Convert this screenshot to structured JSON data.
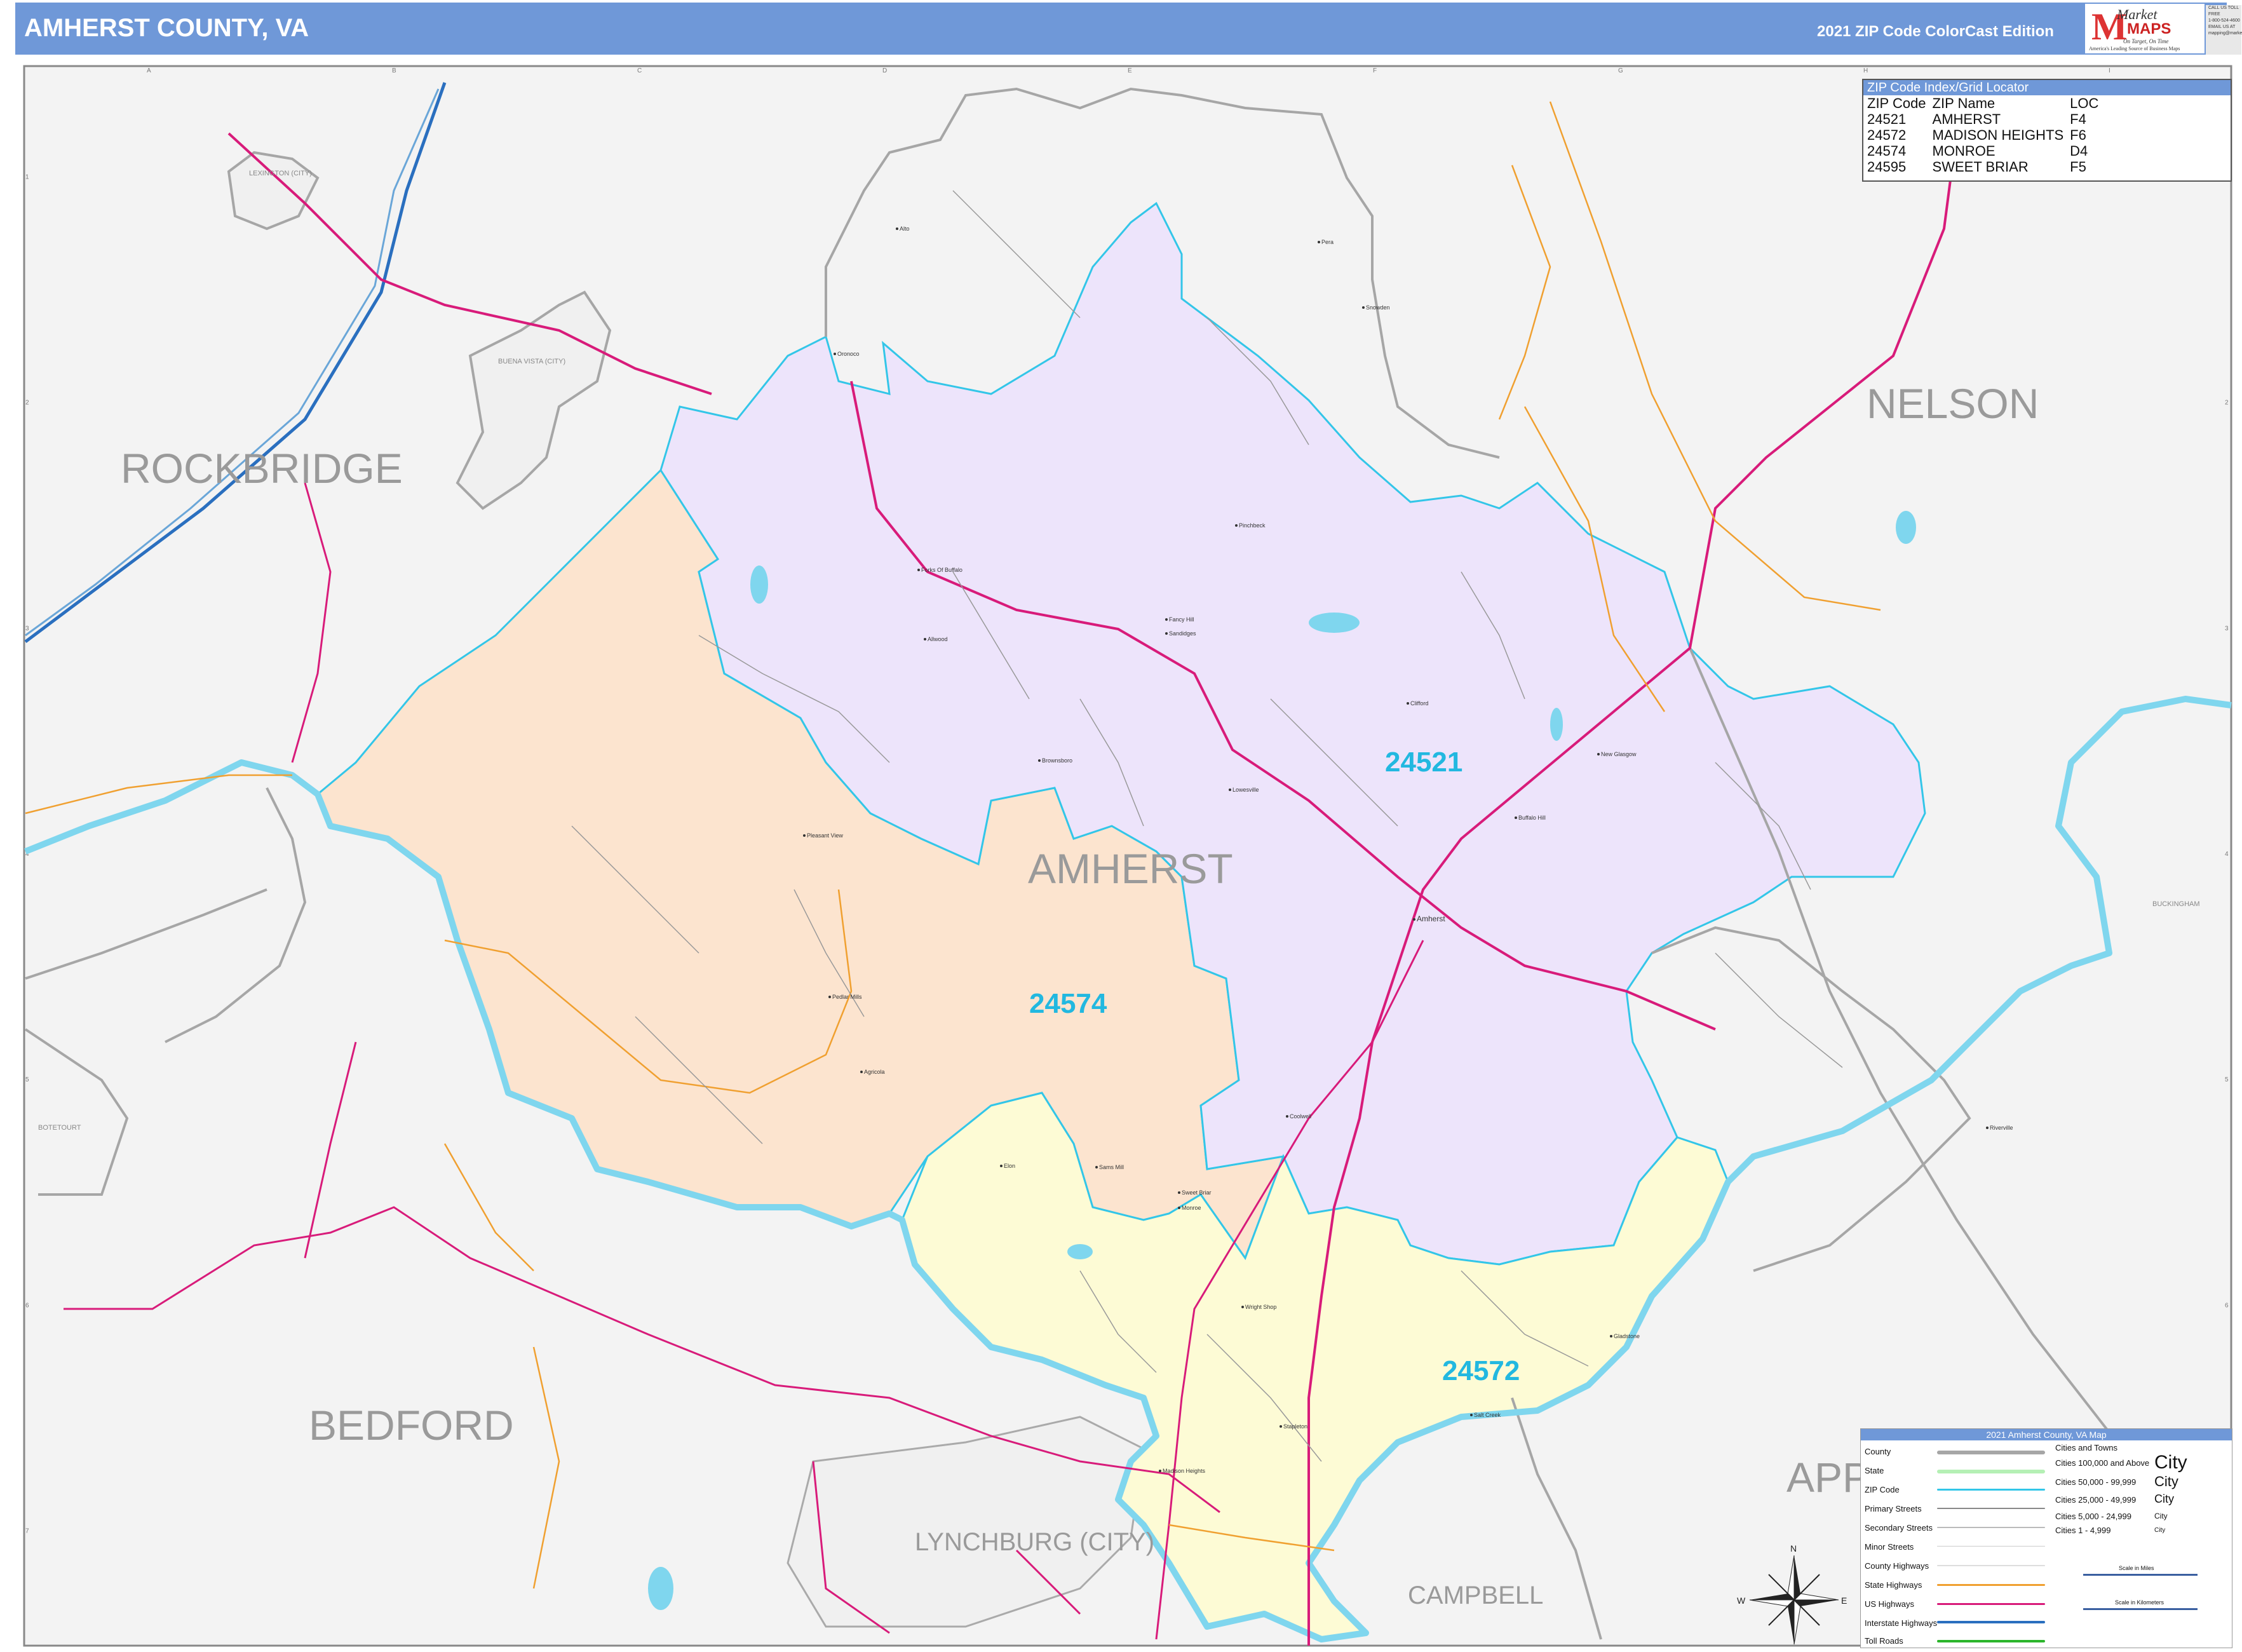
{
  "header": {
    "title": "AMHERST COUNTY, VA",
    "edition": "2021 ZIP Code ColorCast Edition",
    "logo_brand": "Market",
    "logo_maps": "MAPS",
    "logo_tagline": "On Target, On Time",
    "logo_subtitle": "America's Leading Source of Business Maps",
    "contact_lines": [
      "CALL US TOLL FREE",
      "1-800-524-4600",
      "EMAIL US AT",
      "mapping@marketmaps.com"
    ]
  },
  "grid": {
    "columns": [
      "A",
      "B",
      "C",
      "D",
      "E",
      "F",
      "G",
      "H",
      "I"
    ],
    "rows": [
      "1",
      "2",
      "3",
      "4",
      "5",
      "6",
      "7"
    ]
  },
  "counties": {
    "rockbridge": "ROCKBRIDGE",
    "nelson": "NELSON",
    "amherst": "AMHERST",
    "bedford": "BEDFORD",
    "lynchburg": "LYNCHBURG (CITY)",
    "campbell": "CAMPBELL",
    "appomattox": "APP",
    "buena_vista": "BUENA VISTA (CITY)",
    "lexington": "LEXINGTON (CITY)",
    "botetourt": "BOTETOURT",
    "buckingham": "BUCKINGHAM"
  },
  "zip_labels": {
    "z24521": "24521",
    "z24574": "24574",
    "z24572": "24572"
  },
  "places": [
    "Amherst",
    "Madison Heights",
    "Monroe",
    "Sweet Briar",
    "Pedlar Mills",
    "Buffalo Hill",
    "New Glasgow",
    "Clifford",
    "Sandidges",
    "Fancy Hill",
    "Alto",
    "Oronoco",
    "Forks Of Buffalo",
    "Allwood",
    "Brownsboro",
    "Pleasant View",
    "Riverville",
    "Agricola",
    "Elon",
    "Coolwell",
    "Pera",
    "Snowden",
    "Gladstone",
    "Stapleton",
    "Wright Shop",
    "Pinchbeck",
    "Salt Creek",
    "Lowesville",
    "Sams Mill"
  ],
  "zip_index": {
    "title": "ZIP Code Index/Grid Locator",
    "columns": [
      "ZIP Code",
      "ZIP Name",
      "LOC"
    ],
    "rows": [
      [
        "24521",
        "AMHERST",
        "F4"
      ],
      [
        "24572",
        "MADISON HEIGHTS",
        "F6"
      ],
      [
        "24574",
        "MONROE",
        "D4"
      ],
      [
        "24595",
        "SWEET BRIAR",
        "F5"
      ]
    ]
  },
  "legend": {
    "title": "2021 Amherst County, VA Map",
    "items": [
      "County",
      "State",
      "ZIP Code",
      "Primary Streets",
      "Secondary Streets",
      "Minor Streets",
      "County Highways",
      "State Highways",
      "US Highways",
      "Interstate Highways",
      "Toll Roads"
    ],
    "cities_header": "Cities and Towns",
    "city_tiers": [
      {
        "range": "Cities 100,000 and Above",
        "sample": "City"
      },
      {
        "range": "Cities 50,000 - 99,999",
        "sample": "City"
      },
      {
        "range": "Cities 25,000 - 49,999",
        "sample": "City"
      },
      {
        "range": "Cities 5,000 - 24,999",
        "sample": "City"
      },
      {
        "range": "Cities 1 - 4,999",
        "sample": "City"
      }
    ],
    "scale_miles": "Scale in Miles",
    "scale_km": "Scale in Kilometers"
  },
  "compass": {
    "n": "N",
    "s": "S",
    "e": "E",
    "w": "W"
  },
  "colors": {
    "header": "#6f98d8",
    "zip_24521": "#ede4fb",
    "zip_24574": "#fce4cf",
    "zip_24572": "#fdfbd5",
    "zip_border": "#33c6e8",
    "county_border": "#a6a6a6",
    "water": "#7fd6ee",
    "us_highway": "#d81b7a",
    "state_highway": "#f0a030",
    "interstate": "#2a6fbf"
  }
}
